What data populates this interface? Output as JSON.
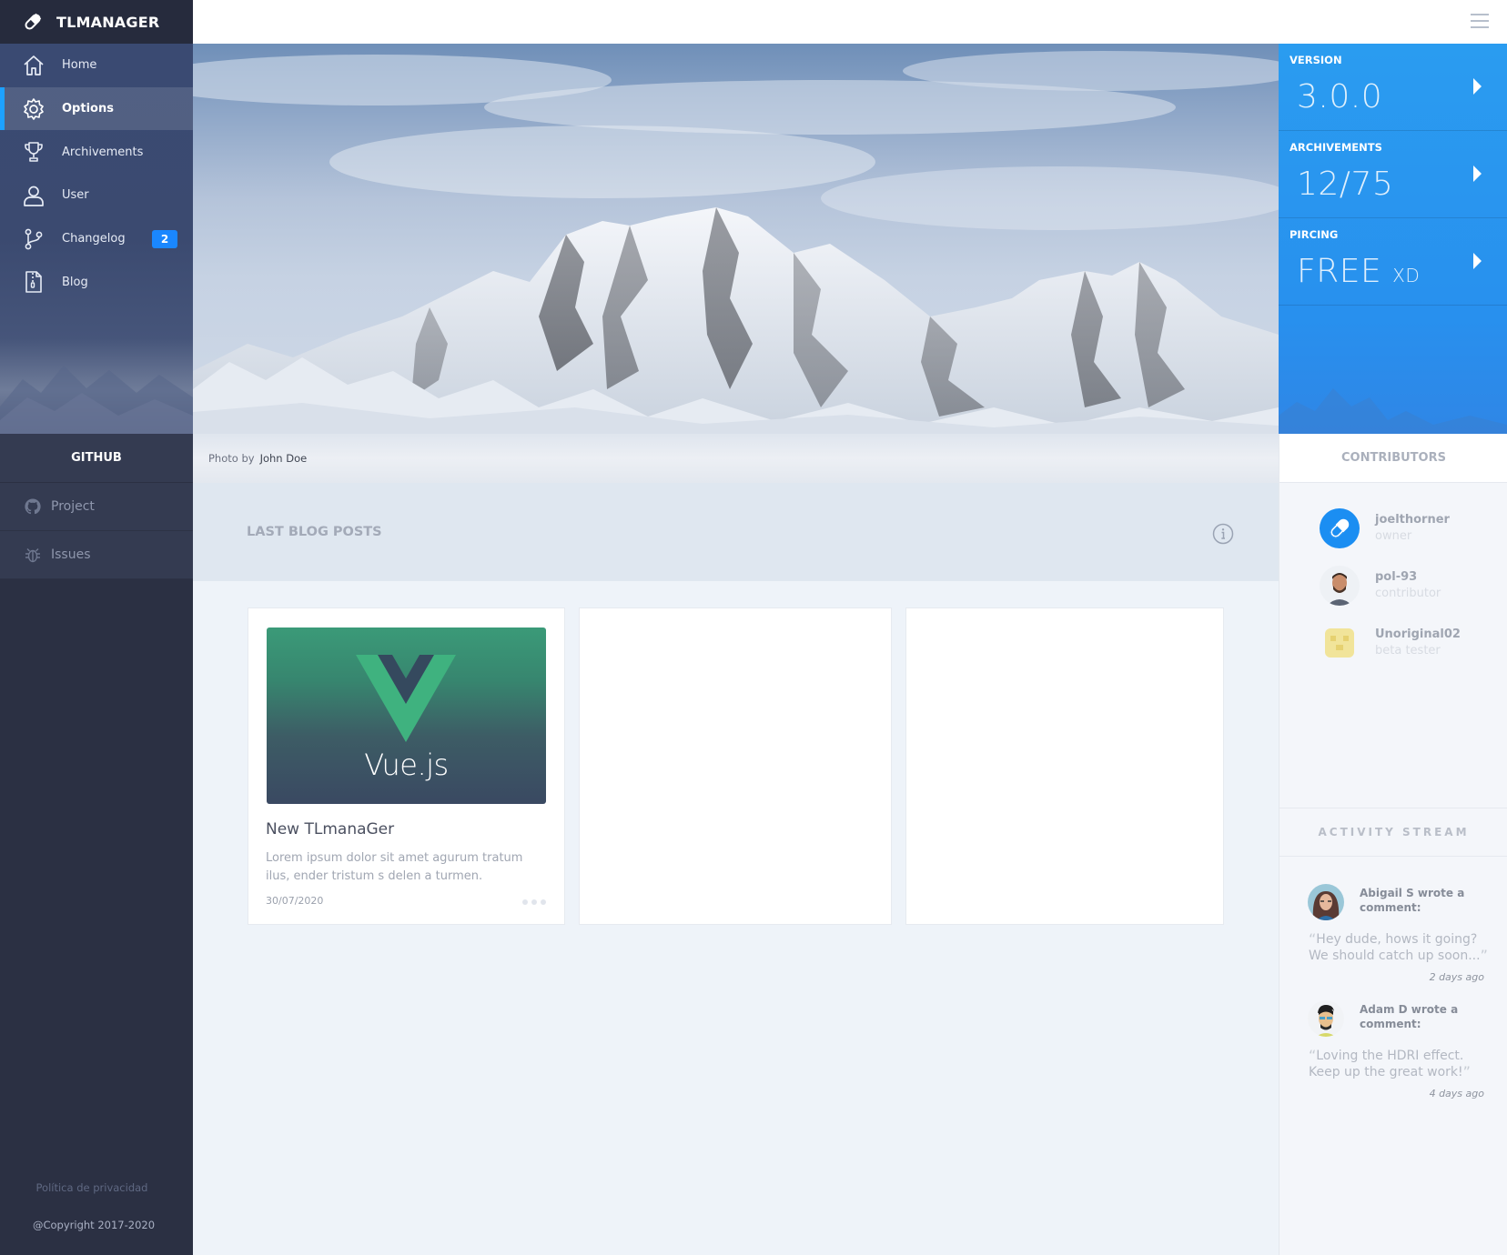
{
  "brand": {
    "name": "TLMANAGER",
    "logo_icon": "pill-icon"
  },
  "nav": {
    "items": [
      {
        "label": "Home",
        "icon": "home-icon"
      },
      {
        "label": "Options",
        "icon": "gear-icon",
        "active": true
      },
      {
        "label": "Archivements",
        "icon": "trophy-icon"
      },
      {
        "label": "User",
        "icon": "user-icon"
      },
      {
        "label": "Changelog",
        "icon": "git-branch-icon",
        "badge": "2"
      },
      {
        "label": "Blog",
        "icon": "zip-file-icon"
      }
    ]
  },
  "github": {
    "title": "GITHUB",
    "items": [
      {
        "label": "Project",
        "icon": "github-icon"
      },
      {
        "label": "Issues",
        "icon": "bug-icon"
      }
    ]
  },
  "footer": {
    "privacy": "Política de privacidad",
    "copyright": "@Copyright 2017-2020"
  },
  "hero": {
    "photo_by_label": "Photo by",
    "photo_author": "John Doe"
  },
  "stats": [
    {
      "label": "VERSION",
      "value": "3.0.0",
      "suffix": ""
    },
    {
      "label": "ARCHIVEMENTS",
      "value": "12/75",
      "suffix": ""
    },
    {
      "label": "PIRCING",
      "value": "FREE",
      "suffix": "XD"
    }
  ],
  "blog": {
    "title": "LAST BLOG POSTS",
    "posts": [
      {
        "image_text": "Vue.js",
        "title": "New TLmanaGer",
        "excerpt": "Lorem ipsum dolor sit amet agurum tratum ilus, ender tristum s delen a turmen.",
        "date": "30/07/2020"
      }
    ]
  },
  "contributors": {
    "title": "CONTRIBUTORS",
    "people": [
      {
        "name": "joelthorner",
        "role": "owner"
      },
      {
        "name": "pol-93",
        "role": "contributor"
      },
      {
        "name": "Unoriginal02",
        "role": "beta tester"
      }
    ]
  },
  "activity": {
    "title": "ACTIVITY STREAM",
    "entries": [
      {
        "who": "Abigail S wrote a comment:",
        "quote": "Hey dude, hows it going? We should catch up soon...",
        "time": "2 days ago"
      },
      {
        "who": "Adam D wrote a comment:",
        "quote": "Loving the HDRI effect. Keep up the great work!",
        "time": "4 days ago"
      }
    ]
  },
  "colors": {
    "accent": "#1da1ff",
    "stats_bg": "#2890ee",
    "sidebar_bg": "#2b3043",
    "badge": "#1a87ff"
  }
}
